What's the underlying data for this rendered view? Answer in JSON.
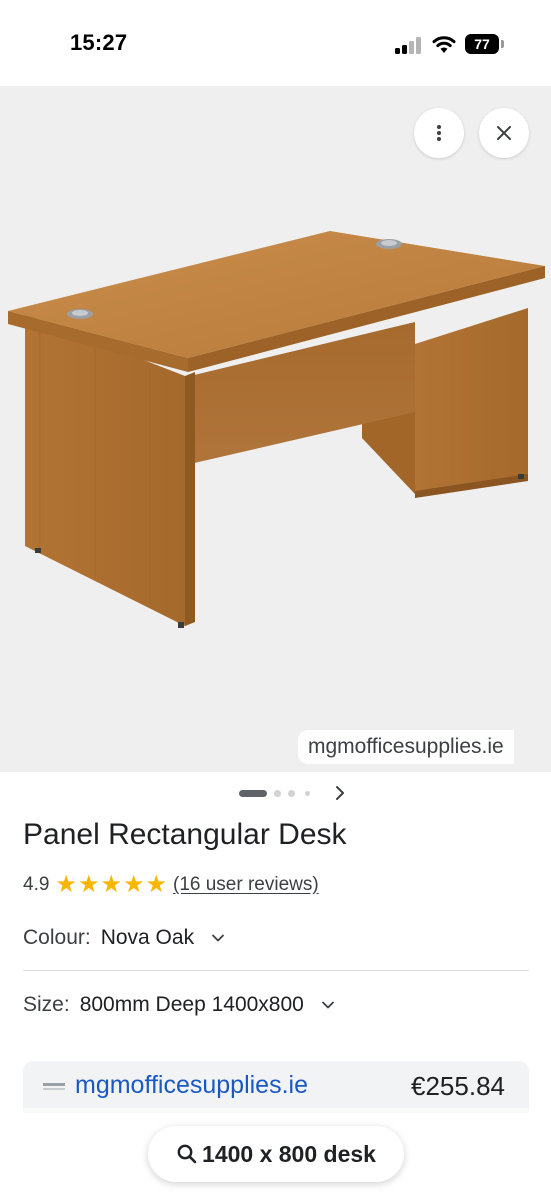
{
  "status_bar": {
    "time": "15:27",
    "battery": "77"
  },
  "image": {
    "source": "mgmofficesupplies.ie",
    "more_icon": "more-vert-icon",
    "close_icon": "close-icon"
  },
  "carousel": {
    "next_icon": "chevron-right-icon"
  },
  "product": {
    "title": "Panel Rectangular Desk",
    "rating": "4.9",
    "stars": 5,
    "reviews": "(16 user reviews)"
  },
  "options": {
    "colour_label": "Colour:",
    "colour_value": "Nova Oak",
    "size_label": "Size:",
    "size_value": "800mm Deep 1400x800"
  },
  "seller": {
    "name": "mgmofficesupplies.ie",
    "price": "€255.84"
  },
  "search": {
    "query": "1400 x 800 desk"
  },
  "colors": {
    "link_blue": "#1a58c4",
    "star_yellow": "#f8b600",
    "image_background": "#efefef"
  }
}
